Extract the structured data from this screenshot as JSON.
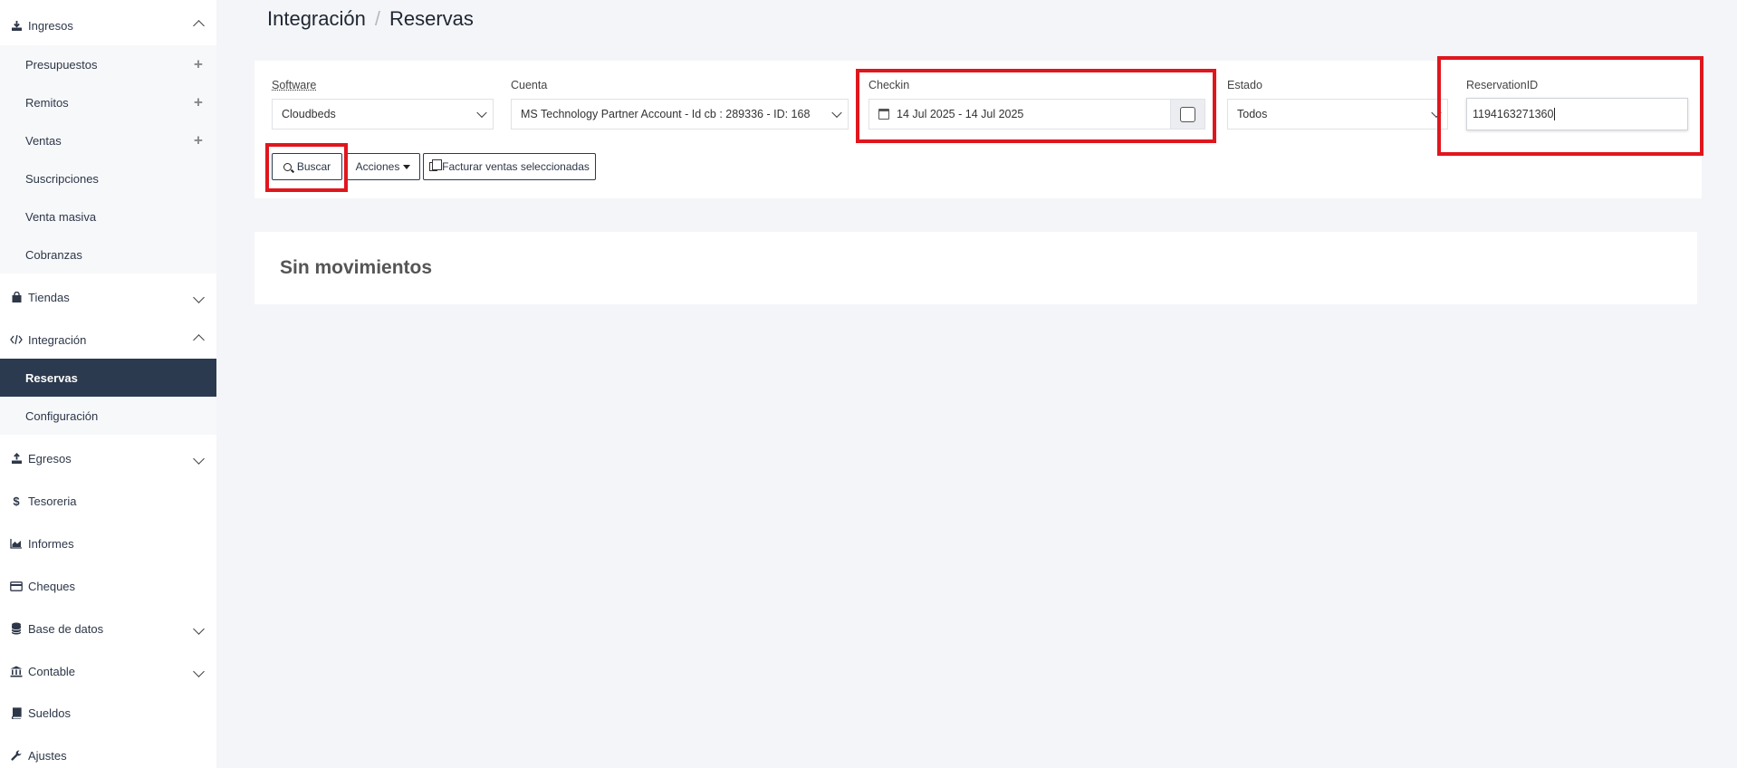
{
  "sidebar": {
    "ingresos": "Ingresos",
    "presupuestos": "Presupuestos",
    "remitos": "Remitos",
    "ventas": "Ventas",
    "suscripciones": "Suscripciones",
    "venta_masiva": "Venta masiva",
    "cobranzas": "Cobranzas",
    "tiendas": "Tiendas",
    "integracion": "Integración",
    "reservas": "Reservas",
    "configuracion": "Configuración",
    "egresos": "Egresos",
    "tesoreria": "Tesoreria",
    "informes": "Informes",
    "cheques": "Cheques",
    "base_de_datos": "Base de datos",
    "contable": "Contable",
    "sueldos": "Sueldos",
    "ajustes": "Ajustes",
    "dollar_glyph": "$"
  },
  "breadcrumb": {
    "parent": "Integración",
    "separator": "/",
    "current": "Reservas"
  },
  "filters": {
    "software_label": "Software",
    "software_value": "Cloudbeds",
    "cuenta_label": "Cuenta",
    "cuenta_value": "MS Technology Partner Account - Id cb : 289336 - ID: 168",
    "checkin_label": "Checkin",
    "checkin_value": "14 Jul 2025 - 14 Jul 2025",
    "estado_label": "Estado",
    "estado_value": "Todos",
    "reservation_label": "ReservationID",
    "reservation_value": "1194163271360"
  },
  "buttons": {
    "buscar": "Buscar",
    "acciones": "Acciones",
    "facturar": "Facturar ventas seleccionadas"
  },
  "result": {
    "empty_title": "Sin movimientos"
  },
  "colors": {
    "sidebar_active": "#2c3a4f",
    "highlight": "#e0161d",
    "background": "#f4f5f8"
  }
}
